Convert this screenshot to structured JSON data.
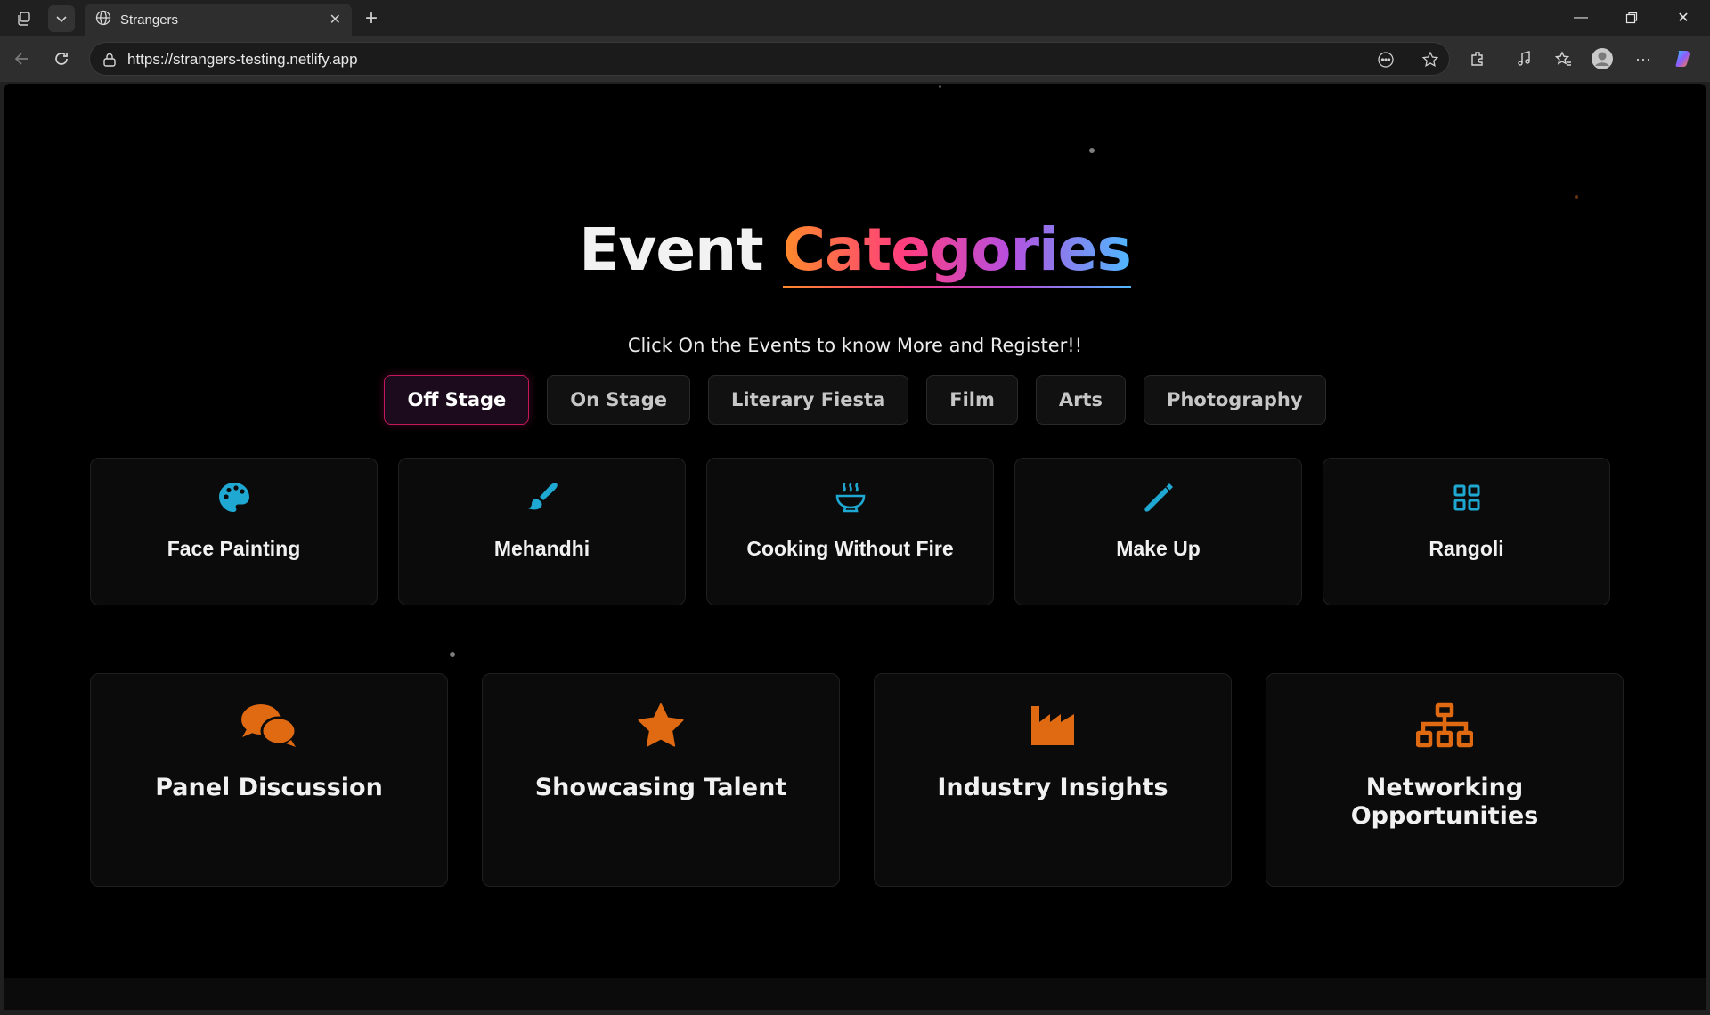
{
  "browser": {
    "tab_title": "Strangers",
    "url": "https://strangers-testing.netlify.app"
  },
  "page": {
    "title_plain": "Event",
    "title_gradient": "Categories",
    "subtitle": "Click On the Events to know More and Register!!",
    "filters": [
      {
        "label": "Off Stage",
        "active": true
      },
      {
        "label": "On Stage",
        "active": false
      },
      {
        "label": "Literary Fiesta",
        "active": false
      },
      {
        "label": "Film",
        "active": false
      },
      {
        "label": "Arts",
        "active": false
      },
      {
        "label": "Photography",
        "active": false
      }
    ],
    "events": [
      {
        "label": "Face Painting",
        "icon": "palette-icon"
      },
      {
        "label": "Mehandhi",
        "icon": "paintbrush-icon"
      },
      {
        "label": "Cooking Without Fire",
        "icon": "bowl-steam-icon"
      },
      {
        "label": "Make Up",
        "icon": "wand-icon"
      },
      {
        "label": "Rangoli",
        "icon": "grid-icon"
      }
    ],
    "features": [
      {
        "label": "Panel Discussion",
        "icon": "chat-bubbles-icon"
      },
      {
        "label": "Showcasing Talent",
        "icon": "star-icon"
      },
      {
        "label": "Industry Insights",
        "icon": "factory-icon"
      },
      {
        "label": "Networking Opportunities",
        "icon": "network-icon"
      }
    ]
  },
  "colors": {
    "event_icon": "#1fa8d1",
    "feature_icon": "#e06a12",
    "active_filter_border": "#c2185b"
  }
}
